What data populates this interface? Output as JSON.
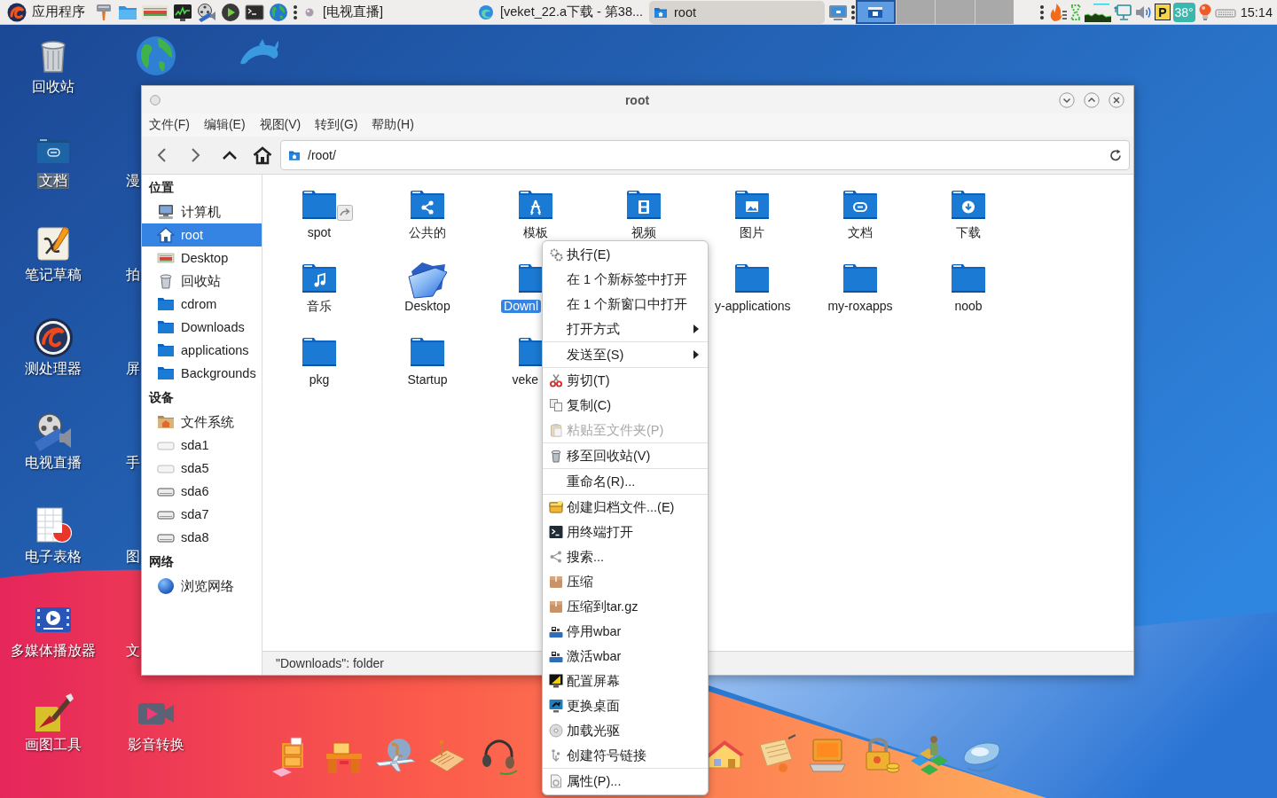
{
  "taskbar": {
    "app_menu": "应用程序",
    "tasks": [
      {
        "label": "[电视直播]",
        "kind": "media",
        "selected": false
      },
      {
        "label": "[veket_22.a下载 - 第38...",
        "kind": "browser",
        "selected": false
      },
      {
        "label": "root",
        "kind": "files",
        "selected": true
      }
    ],
    "workspaces": [
      {
        "selected": true
      },
      {
        "selected": false
      },
      {
        "selected": false
      },
      {
        "selected": false
      }
    ],
    "indicator": "P",
    "temperature": "38°",
    "clock": "15:14"
  },
  "desktop": {
    "column_1": [
      {
        "label": "回收站",
        "kind": "trash",
        "selected": false
      },
      {
        "label": "文档",
        "kind": "documents",
        "selected": true
      },
      {
        "label": "笔记草稿",
        "kind": "notes",
        "selected": false
      },
      {
        "label": "测处理器",
        "kind": "processor",
        "selected": false
      },
      {
        "label": "电视直播",
        "kind": "tv",
        "selected": false
      },
      {
        "label": "电子表格",
        "kind": "spreadsheet",
        "selected": false
      },
      {
        "label": "多媒体播放器",
        "kind": "player",
        "selected": false
      },
      {
        "label": "画图工具",
        "kind": "paint",
        "selected": false
      }
    ],
    "column_2": [
      {
        "label": "漫"
      },
      {
        "label": "拍"
      },
      {
        "label": "屏"
      },
      {
        "label": "手"
      },
      {
        "label": "图"
      },
      {
        "label": "文"
      },
      {
        "label": "影音转换",
        "kind": "converter"
      }
    ]
  },
  "file_manager": {
    "title": "root",
    "menu": [
      "文件(F)",
      "编辑(E)",
      "视图(V)",
      "转到(G)",
      "帮助(H)"
    ],
    "address": "/root/",
    "sidebar": [
      {
        "heading": "位置",
        "items": [
          {
            "label": "计算机",
            "kind": "computer",
            "selected": false
          },
          {
            "label": "root",
            "kind": "home",
            "selected": true
          },
          {
            "label": "Desktop",
            "kind": "desktop",
            "selected": false
          },
          {
            "label": "回收站",
            "kind": "trash",
            "selected": false
          },
          {
            "label": "cdrom",
            "kind": "folder",
            "selected": false
          },
          {
            "label": "Downloads",
            "kind": "folder",
            "selected": false
          },
          {
            "label": "applications",
            "kind": "folder",
            "selected": false
          },
          {
            "label": "Backgrounds",
            "kind": "folder",
            "selected": false
          }
        ]
      },
      {
        "heading": "设备",
        "items": [
          {
            "label": "文件系统",
            "kind": "filesystem",
            "selected": false
          },
          {
            "label": "sda1",
            "kind": "drive",
            "selected": false
          },
          {
            "label": "sda5",
            "kind": "drive",
            "selected": false
          },
          {
            "label": "sda6",
            "kind": "mounted",
            "selected": false
          },
          {
            "label": "sda7",
            "kind": "mounted",
            "selected": false
          },
          {
            "label": "sda8",
            "kind": "mounted",
            "selected": false
          }
        ]
      },
      {
        "heading": "网络",
        "items": [
          {
            "label": "浏览网络",
            "kind": "network",
            "selected": false
          }
        ]
      }
    ],
    "file_columns": [
      [
        {
          "name": "spot",
          "kind": "link",
          "selected": false
        },
        {
          "name": "音乐",
          "kind": "music",
          "selected": false
        },
        {
          "name": "pkg",
          "kind": "plain",
          "selected": false
        }
      ],
      [
        {
          "name": "公共的",
          "kind": "share",
          "selected": false
        },
        {
          "name": "Desktop",
          "kind": "glossy",
          "selected": false
        },
        {
          "name": "Startup",
          "kind": "plain",
          "selected": false
        }
      ],
      [
        {
          "name": "模板",
          "kind": "template",
          "selected": false
        },
        {
          "name": "Downl",
          "kind": "plain",
          "selected": true
        },
        {
          "name": "veke",
          "kind": "plain",
          "selected": false
        }
      ],
      [
        {
          "name": "视频",
          "kind": "video",
          "selected": false
        }
      ],
      [
        {
          "name": "图片",
          "kind": "picture",
          "selected": false
        },
        {
          "name": "y-applications",
          "kind": "plain",
          "selected": false
        }
      ],
      [
        {
          "name": "文档",
          "kind": "document",
          "selected": false
        },
        {
          "name": "my-roxapps",
          "kind": "plain",
          "selected": false
        }
      ],
      [
        {
          "name": "下载",
          "kind": "download",
          "selected": false
        },
        {
          "name": "noob",
          "kind": "plain",
          "selected": false
        }
      ]
    ],
    "status": "\"Downloads\": folder"
  },
  "context_menu": {
    "groups": [
      [
        {
          "label": "执行(E)",
          "kind": "run",
          "disabled": false,
          "submenu": false
        },
        {
          "label": "在 1 个新标签中打开",
          "kind": "plain",
          "disabled": false,
          "submenu": false
        },
        {
          "label": "在 1 个新窗口中打开",
          "kind": "plain",
          "disabled": false,
          "submenu": false
        },
        {
          "label": "打开方式",
          "kind": "plain",
          "disabled": false,
          "submenu": true
        }
      ],
      [
        {
          "label": "发送至(S)",
          "kind": "plain",
          "disabled": false,
          "submenu": true
        }
      ],
      [
        {
          "label": "剪切(T)",
          "kind": "cut",
          "disabled": false,
          "submenu": false
        },
        {
          "label": "复制(C)",
          "kind": "copy",
          "disabled": false,
          "submenu": false
        },
        {
          "label": "粘贴至文件夹(P)",
          "kind": "paste",
          "disabled": true,
          "submenu": false
        }
      ],
      [
        {
          "label": "移至回收站(V)",
          "kind": "trash",
          "disabled": false,
          "submenu": false
        }
      ],
      [
        {
          "label": "重命名(R)...",
          "kind": "plain",
          "disabled": false,
          "submenu": false
        }
      ],
      [
        {
          "label": "创建归档文件...(E)",
          "kind": "archive",
          "disabled": false,
          "submenu": false
        },
        {
          "label": "用终端打开",
          "kind": "terminal",
          "disabled": false,
          "submenu": false
        },
        {
          "label": "搜索...",
          "kind": "search",
          "disabled": false,
          "submenu": false
        },
        {
          "label": "压缩",
          "kind": "package",
          "disabled": false,
          "submenu": false
        },
        {
          "label": "压缩到tar.gz",
          "kind": "package",
          "disabled": false,
          "submenu": false
        },
        {
          "label": "停用wbar",
          "kind": "dock",
          "disabled": false,
          "submenu": false
        },
        {
          "label": "激活wbar",
          "kind": "dock",
          "disabled": false,
          "submenu": false
        },
        {
          "label": "配置屏幕",
          "kind": "display",
          "disabled": false,
          "submenu": false
        },
        {
          "label": "更换桌面",
          "kind": "wallpaper",
          "disabled": false,
          "submenu": false
        },
        {
          "label": "加载光驱",
          "kind": "disc",
          "disabled": false,
          "submenu": false
        },
        {
          "label": "创建符号链接",
          "kind": "symlink",
          "disabled": false,
          "submenu": false
        }
      ],
      [
        {
          "label": "属性(P)...",
          "kind": "properties",
          "disabled": false,
          "submenu": false
        }
      ]
    ]
  }
}
